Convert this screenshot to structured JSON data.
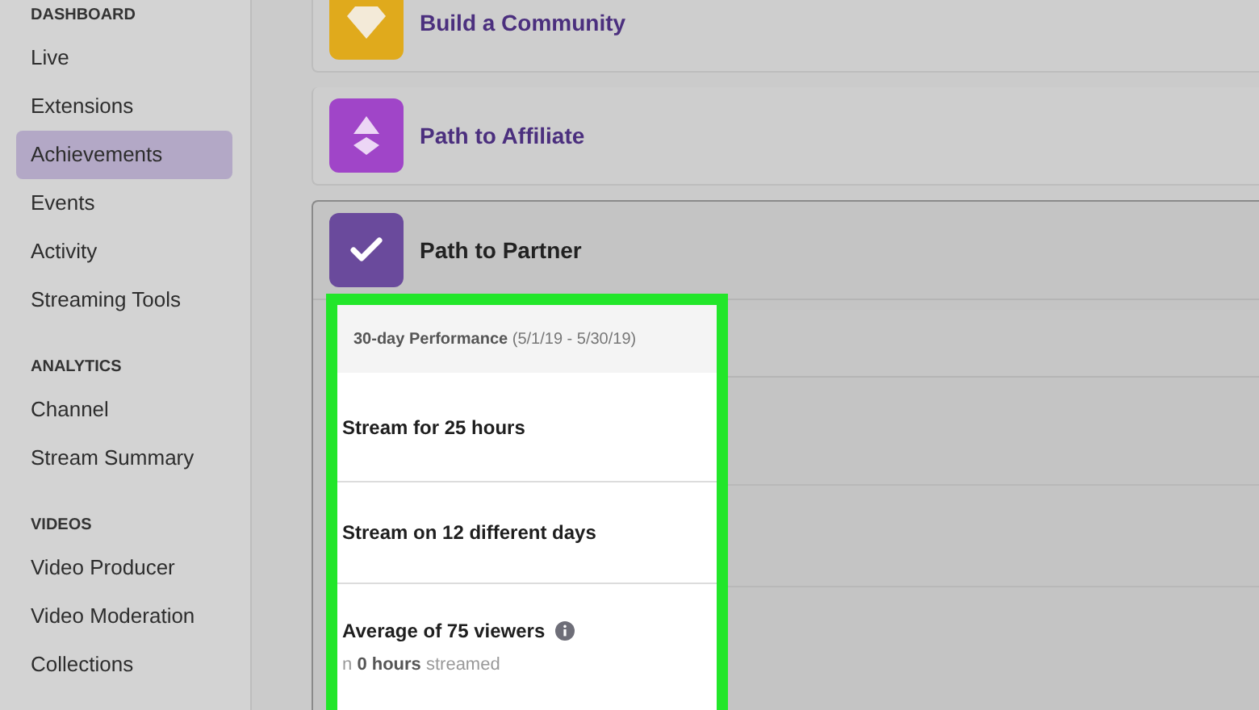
{
  "sidebar": {
    "sections": [
      {
        "heading": "DASHBOARD",
        "items": [
          {
            "label": "Live",
            "selected": false
          },
          {
            "label": "Extensions",
            "selected": false
          },
          {
            "label": "Achievements",
            "selected": true
          },
          {
            "label": "Events",
            "selected": false
          },
          {
            "label": "Activity",
            "selected": false
          },
          {
            "label": "Streaming Tools",
            "selected": false
          }
        ]
      },
      {
        "heading": "ANALYTICS",
        "items": [
          {
            "label": "Channel",
            "selected": false
          },
          {
            "label": "Stream Summary",
            "selected": false
          }
        ]
      },
      {
        "heading": "VIDEOS",
        "items": [
          {
            "label": "Video Producer",
            "selected": false
          },
          {
            "label": "Video Moderation",
            "selected": false
          },
          {
            "label": "Collections",
            "selected": false
          }
        ]
      }
    ]
  },
  "achievements": [
    {
      "title": "Build a Community",
      "kind": "gem",
      "color": "#e0aa1c",
      "expanded": false
    },
    {
      "title": "Path to Affiliate",
      "kind": "affiliate",
      "color": "#a045c8",
      "expanded": false
    },
    {
      "title": "Path to Partner",
      "kind": "check",
      "color": "#6a4a9c",
      "expanded": true
    }
  ],
  "performance": {
    "header": "**30-day Performance** (5/1/19 - 5/30/19)",
    "goals": [
      {
        "title": "Stream for 25 hours",
        "info": false
      },
      {
        "title": "Stream on 12 different days",
        "info": false
      },
      {
        "title": "Average of 75 viewers",
        "info": true,
        "detail": "n **0 hours** streamed"
      }
    ]
  }
}
